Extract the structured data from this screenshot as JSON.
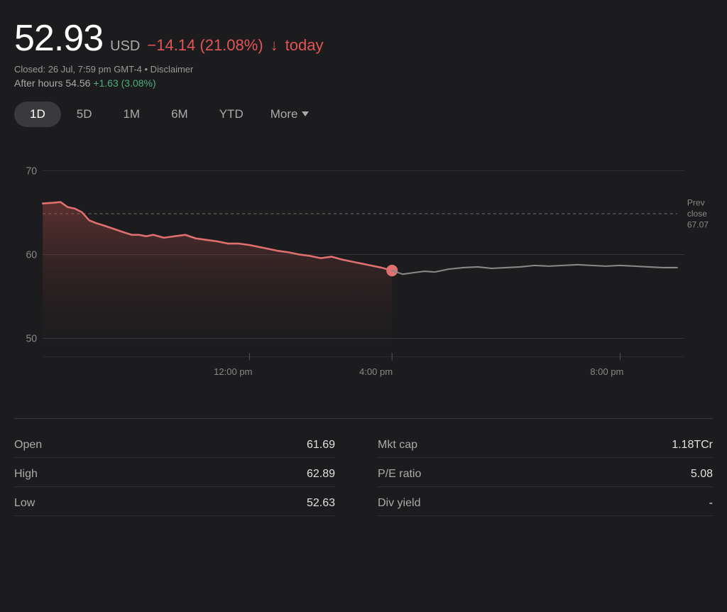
{
  "price": {
    "value": "52.93",
    "currency": "USD",
    "change": "−14.14 (21.08%)",
    "arrow": "↓",
    "today_label": "today",
    "meta": "Closed: 26 Jul, 7:59 pm GMT-4 • Disclaimer",
    "after_hours_label": "After hours",
    "after_hours_value": "54.56",
    "after_hours_change": "+1.63 (3.08%)"
  },
  "tabs": [
    {
      "id": "1d",
      "label": "1D",
      "active": true
    },
    {
      "id": "5d",
      "label": "5D",
      "active": false
    },
    {
      "id": "1m",
      "label": "1M",
      "active": false
    },
    {
      "id": "6m",
      "label": "6M",
      "active": false
    },
    {
      "id": "ytd",
      "label": "YTD",
      "active": false
    }
  ],
  "more_label": "More",
  "chart": {
    "y_labels": [
      "70",
      "60",
      "50"
    ],
    "x_labels": [
      "12:00 pm",
      "4:00 pm",
      "8:00 pm"
    ],
    "prev_close_label": "Prev\nclose\n67.07",
    "prev_close_value": "67.07"
  },
  "stats": {
    "left": [
      {
        "label": "Open",
        "value": "61.69"
      },
      {
        "label": "High",
        "value": "62.89"
      },
      {
        "label": "Low",
        "value": "52.63"
      }
    ],
    "right": [
      {
        "label": "Mkt cap",
        "value": "1.18TCr"
      },
      {
        "label": "P/E ratio",
        "value": "5.08"
      },
      {
        "label": "Div yield",
        "value": "-"
      }
    ]
  }
}
